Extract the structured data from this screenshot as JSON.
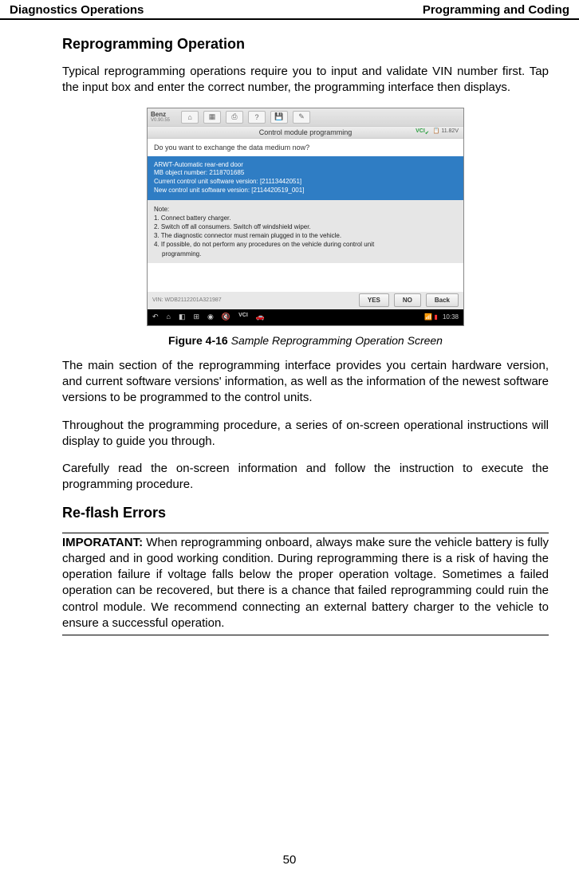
{
  "header": {
    "left": "Diagnostics Operations",
    "right": "Programming and Coding"
  },
  "section1": {
    "title": "Reprogramming Operation",
    "para1": "Typical reprogramming operations require you to input and validate VIN number first. Tap the input box and enter the correct number, the programming interface then displays."
  },
  "screenshot": {
    "brand": "Benz",
    "version": "V0.90.55",
    "toolbar_icons": [
      "home-icon",
      "grid-icon",
      "print-icon",
      "help-icon",
      "save-icon",
      "edit-icon"
    ],
    "title": "Control module programming",
    "vci_label": "VCI",
    "volt": "11.82V",
    "question": "Do you want to exchange the data medium now?",
    "blue": {
      "l1": "ARWT-Automatic rear-end door",
      "l2": "MB object number: 2118701685",
      "l3": "Current control unit software version: [21113442051]",
      "l4": "New control unit software version: [2114420519_001]"
    },
    "note_title": "Note:",
    "note1": "1. Connect battery charger.",
    "note2": "2. Switch off all consumers. Switch off windshield wiper.",
    "note3": "3. The diagnostic connector must remain plugged in to the vehicle.",
    "note4": "4. If possible, do not perform any procedures on the vehicle during control unit",
    "note4b": "programming.",
    "vin": "VIN: WDB2112201A321987",
    "btn_yes": "YES",
    "btn_no": "NO",
    "btn_back": "Back",
    "bottom_icons": [
      "back-icon",
      "home-nav-icon",
      "recent-icon",
      "windows-icon",
      "camera-icon",
      "speaker-icon",
      "vci-nav-icon",
      "car-icon"
    ],
    "vci_nav_label": "VCI",
    "time": "10:38"
  },
  "figure": {
    "label": "Figure 4-16",
    "caption": " Sample Reprogramming Operation Screen"
  },
  "section2": {
    "para1": "The main section of the reprogramming interface provides you certain hardware version, and current software versions' information, as well as the information of the newest software versions to be programmed to the control units.",
    "para2": "Throughout the programming procedure, a series of on-screen operational instructions will display to guide you through.",
    "para3": "Carefully read the on-screen information and follow the instruction to execute the programming procedure."
  },
  "section3": {
    "title": "Re-flash Errors",
    "important_label": "IMPORATANT:",
    "important_text": " When reprogramming onboard, always make sure the vehicle battery is fully charged and in good working condition. During reprogramming there is a risk of having the operation failure if voltage falls below the proper operation voltage. Sometimes a failed operation can be recovered, but there is a chance that failed reprogramming could ruin the control module. We recommend connecting an external battery charger to the vehicle to ensure a successful operation."
  },
  "page_number": "50"
}
